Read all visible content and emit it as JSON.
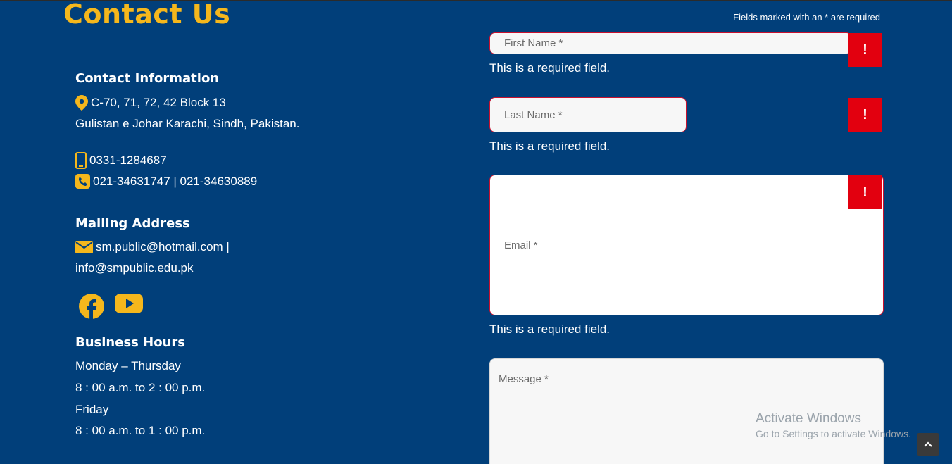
{
  "page": {
    "title": "Contact Us"
  },
  "contact": {
    "heading": "Contact Information",
    "address_line1": "C-70, 71, 72, 42 Block 13",
    "address_line2": "Gulistan e Johar Karachi, Sindh, Pakistan.",
    "mobile": "0331-1284687",
    "phones": "021-34631747 | 021-34630889"
  },
  "mailing": {
    "heading": "Mailing Address",
    "email_line1": "sm.public@hotmail.com |",
    "email_line2": "info@smpublic.edu.pk"
  },
  "social": {
    "icons": [
      "facebook-icon",
      "youtube-icon"
    ]
  },
  "hours": {
    "heading": "Business Hours",
    "line1": "Monday – Thursday",
    "line2": "8 : 00 a.m. to 2 : 00 p.m.",
    "line3": "Friday",
    "line4": "8 : 00 a.m. to 1 : 00 p.m."
  },
  "form": {
    "required_note": "Fields marked with an * are required",
    "first_name_placeholder": "First Name *",
    "last_name_placeholder": "Last Name *",
    "email_placeholder": "Email *",
    "message_placeholder": "Message *",
    "error_text": "This is a required field.",
    "error_badge": "!"
  },
  "watermark": {
    "title": "Activate Windows",
    "subtitle": "Go to Settings to activate Windows."
  },
  "colors": {
    "background": "#013f7a",
    "accent": "#f5b71c",
    "error": "#e2000f"
  }
}
